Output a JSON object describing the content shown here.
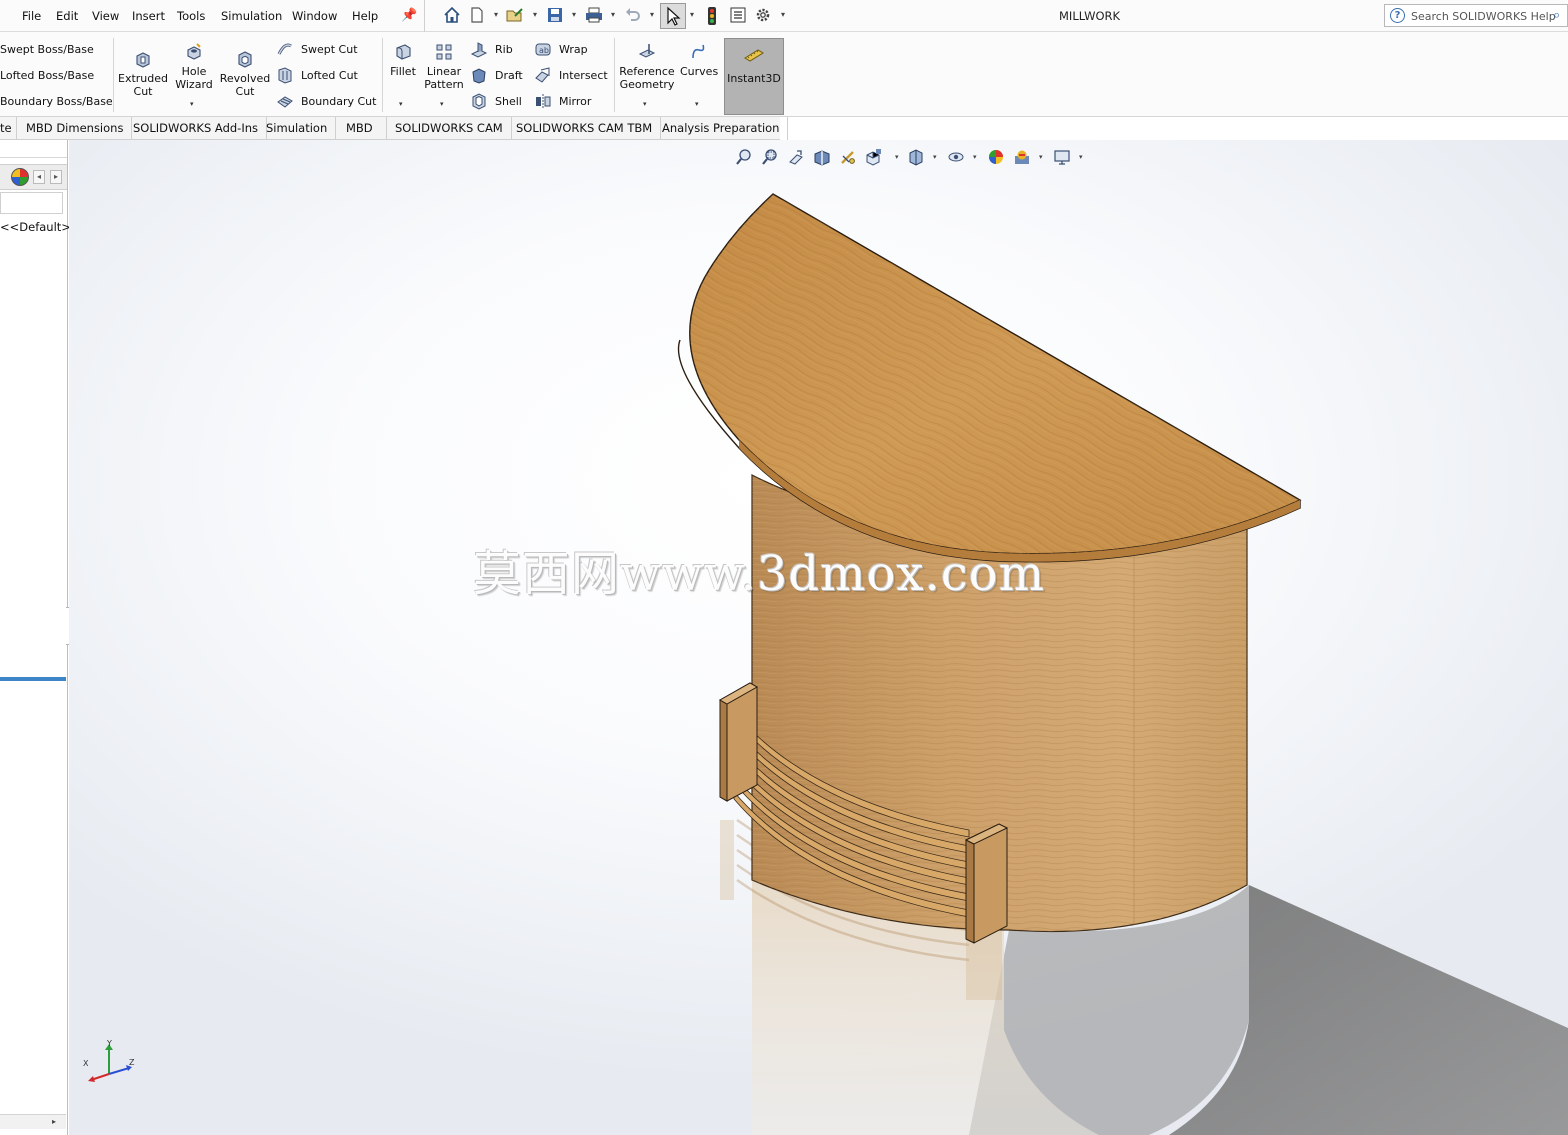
{
  "menu": {
    "items": [
      "File",
      "Edit",
      "View",
      "Insert",
      "Tools",
      "Simulation",
      "Window",
      "Help"
    ]
  },
  "quick_access": {
    "icons": [
      "home-icon",
      "new-document-icon",
      "open-icon",
      "save-icon",
      "print-icon",
      "undo-icon",
      "select-arrow-icon",
      "rebuild-traffic-light-icon",
      "file-properties-icon",
      "options-gear-icon"
    ]
  },
  "window": {
    "title": "MILLWORK"
  },
  "search": {
    "placeholder": "Search SOLIDWORKS Help"
  },
  "ribbon": {
    "boss_column": [
      "Swept Boss/Base",
      "Lofted Boss/Base",
      "Boundary Boss/Base"
    ],
    "extruded_cut": [
      "Extruded",
      "Cut"
    ],
    "hole_wizard": [
      "Hole",
      "Wizard"
    ],
    "revolved_cut": [
      "Revolved",
      "Cut"
    ],
    "cut_column": [
      "Swept Cut",
      "Lofted Cut",
      "Boundary Cut"
    ],
    "fillet": "Fillet",
    "linear_pattern": [
      "Linear",
      "Pattern"
    ],
    "feature_column": [
      "Rib",
      "Draft",
      "Shell"
    ],
    "wrap_column": [
      "Wrap",
      "Intersect",
      "Mirror"
    ],
    "reference_geometry": [
      "Reference",
      "Geometry"
    ],
    "curves": "Curves",
    "instant3d": "Instant3D"
  },
  "tabs": [
    "te",
    "MBD Dimensions",
    "SOLIDWORKS Add-Ins",
    "Simulation",
    "MBD",
    "SOLIDWORKS CAM",
    "SOLIDWORKS CAM TBM",
    "Analysis Preparation"
  ],
  "left_panel": {
    "config_text": "<<Default>_"
  },
  "heads_up_toolbar": {
    "icons": [
      "zoom-to-fit-icon",
      "zoom-to-area-icon",
      "previous-view-icon",
      "section-view-icon",
      "dynamic-annotation-icon",
      "view-orientation-icon",
      "display-style-icon",
      "hide-show-icon",
      "edit-appearance-icon",
      "apply-scene-icon",
      "view-settings-icon"
    ]
  },
  "watermark": {
    "text": "莫西网www.3dmox.com"
  },
  "triad": {
    "x_label": "X",
    "y_label": "Y",
    "z_label": "Z"
  },
  "colors": {
    "wood_top": "#c8924a",
    "wood_side": "#c99a5a",
    "selected_tool": "#b3b3b3",
    "panel_accent": "#3d85c6"
  }
}
